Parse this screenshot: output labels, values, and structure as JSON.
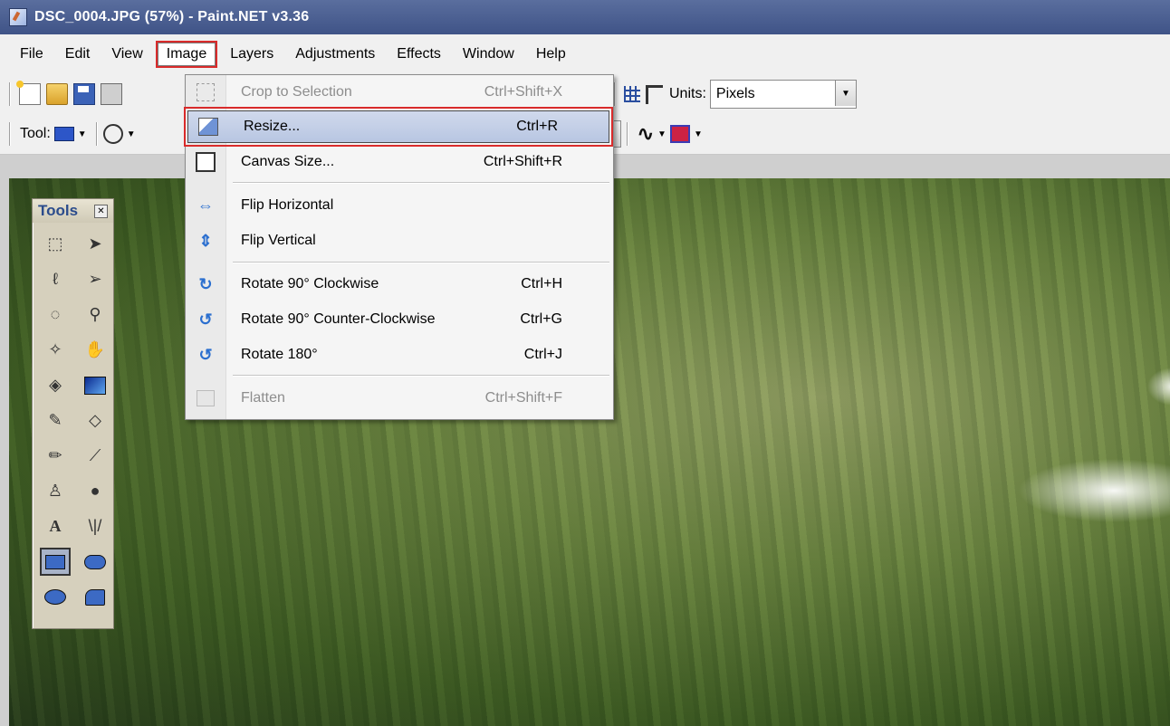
{
  "window": {
    "title": "DSC_0004.JPG (57%) - Paint.NET v3.36"
  },
  "menubar": {
    "items": [
      {
        "label": "File"
      },
      {
        "label": "Edit"
      },
      {
        "label": "View"
      },
      {
        "label": "Image"
      },
      {
        "label": "Layers"
      },
      {
        "label": "Adjustments"
      },
      {
        "label": "Effects"
      },
      {
        "label": "Window"
      },
      {
        "label": "Help"
      }
    ],
    "active": "Image"
  },
  "toolbar": {
    "units_label": "Units:",
    "units_value": "Pixels",
    "tool_label": "Tool:"
  },
  "image_menu": {
    "items": [
      {
        "label": "Crop to Selection",
        "shortcut": "Ctrl+Shift+X",
        "icon": "crop-icon",
        "enabled": false
      },
      {
        "label": "Resize...",
        "shortcut": "Ctrl+R",
        "icon": "resize-icon",
        "enabled": true,
        "highlighted": true
      },
      {
        "label": "Canvas Size...",
        "shortcut": "Ctrl+Shift+R",
        "icon": "canvas-size-icon",
        "enabled": true
      },
      {
        "label": "Flip Horizontal",
        "shortcut": "",
        "icon": "flip-horizontal-icon",
        "enabled": true
      },
      {
        "label": "Flip Vertical",
        "shortcut": "",
        "icon": "flip-vertical-icon",
        "enabled": true
      },
      {
        "label": "Rotate 90° Clockwise",
        "shortcut": "Ctrl+H",
        "icon": "rotate-clockwise-icon",
        "enabled": true
      },
      {
        "label": "Rotate 90° Counter-Clockwise",
        "shortcut": "Ctrl+G",
        "icon": "rotate-counter-clockwise-icon",
        "enabled": true
      },
      {
        "label": "Rotate 180°",
        "shortcut": "Ctrl+J",
        "icon": "rotate-180-icon",
        "enabled": true
      },
      {
        "label": "Flatten",
        "shortcut": "Ctrl+Shift+F",
        "icon": "flatten-icon",
        "enabled": false
      }
    ]
  },
  "tools_panel": {
    "title": "Tools",
    "tools": [
      "rectangle-select-icon",
      "move-selection-icon",
      "lasso-select-icon",
      "move-selected-icon",
      "ellipse-select-icon",
      "zoom-icon",
      "magic-wand-icon",
      "pan-icon",
      "paint-bucket-icon",
      "gradient-icon",
      "paintbrush-icon",
      "eraser-icon",
      "pencil-icon",
      "color-picker-icon",
      "clone-stamp-icon",
      "recolor-icon",
      "text-icon",
      "line-curve-icon",
      "rectangle-icon",
      "rounded-rectangle-icon",
      "ellipse-icon",
      "freeform-shape-icon"
    ],
    "selected": "rectangle-icon"
  },
  "colors": {
    "highlight_outline": "#d92b2b",
    "menu_highlight": "#c3cfe8",
    "titlebar": "#4a5e92"
  }
}
